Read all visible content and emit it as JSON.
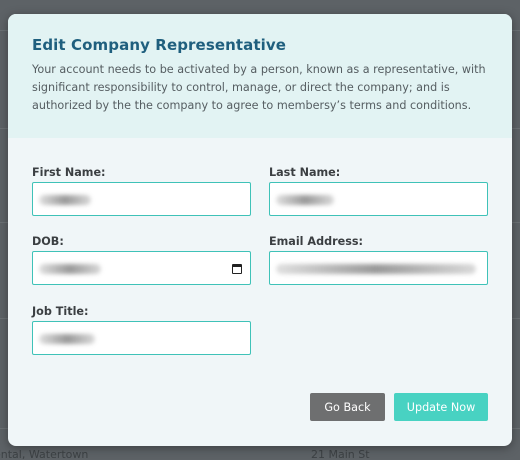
{
  "background": {
    "fragment_left": "ental, Watertown",
    "fragment_right": "21 Main St"
  },
  "modal": {
    "title": "Edit Company Representative",
    "description": "Your account needs to be activated by a person, known as a representative, with significant responsibility to control, manage, or direct the company; and is authorized by the the company to agree to membersy’s terms and conditions."
  },
  "form": {
    "first_name": {
      "label": "First Name:"
    },
    "last_name": {
      "label": "Last Name:"
    },
    "dob": {
      "label": "DOB:",
      "icon": "calendar-icon"
    },
    "email": {
      "label": "Email Address:"
    },
    "job_title": {
      "label": "Job Title:"
    }
  },
  "actions": {
    "back_label": "Go Back",
    "update_label": "Update Now"
  },
  "colors": {
    "title": "#1f5f7e",
    "input_border": "#3fc2b8",
    "update_button": "#48d2c2",
    "back_button": "#6e6f70",
    "header_bg": "#e2f3f3"
  }
}
